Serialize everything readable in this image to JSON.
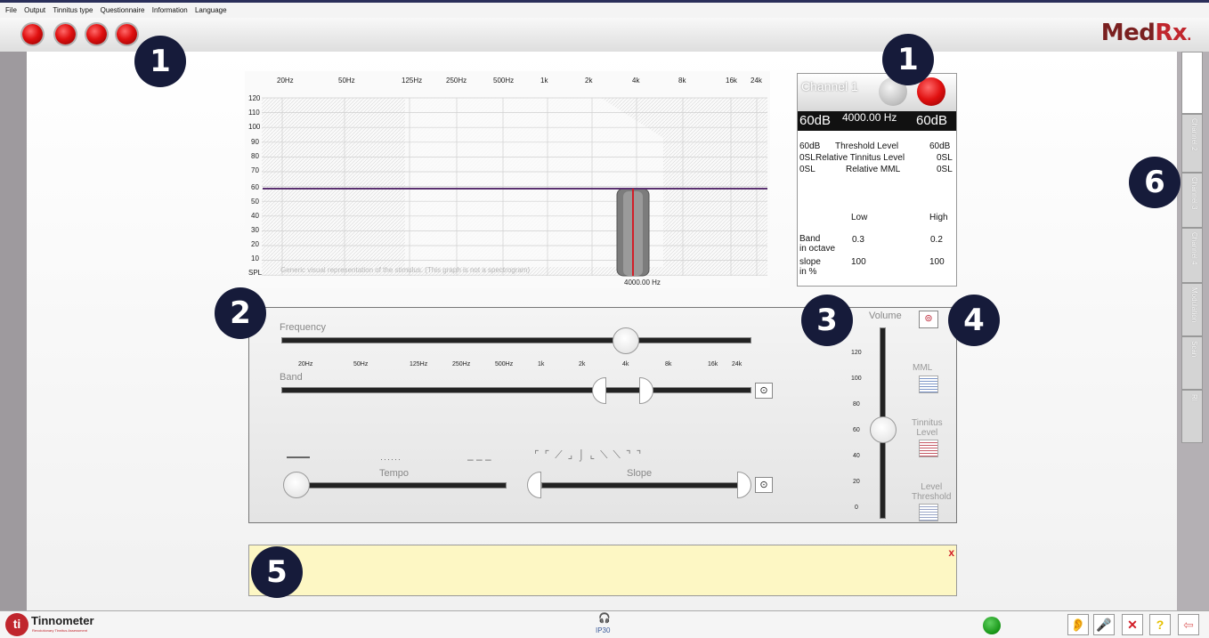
{
  "menu": [
    "File",
    "Output",
    "Tinnitus type",
    "Questionnaire",
    "Information",
    "Language"
  ],
  "logo": {
    "med": "Med",
    "rx": "Rx",
    "dot": "."
  },
  "badges": [
    "1",
    "1",
    "2",
    "3",
    "4",
    "5",
    "6"
  ],
  "graph": {
    "freq_labels": [
      "20Hz",
      "50Hz",
      "125Hz",
      "250Hz",
      "500Hz",
      "1k",
      "2k",
      "4k",
      "8k",
      "16k",
      "24k"
    ],
    "y_labels": [
      "120",
      "110",
      "100",
      "90",
      "80",
      "70",
      "60",
      "50",
      "40",
      "30",
      "20",
      "10",
      "SPL"
    ],
    "caption": "Generic visual representation of the stimulus. (This graph is not a spectrogram)",
    "freq_readout": "4000.00 Hz",
    "level_line_db": 60,
    "accent": "#d21e28",
    "line_color": "#5a3070"
  },
  "channel": {
    "title": "Channel 1",
    "left_db": "60dB",
    "freq": "4000.00 Hz",
    "right_db": "60dB",
    "rows": [
      {
        "left": "60dB",
        "label": "Threshold Level",
        "right": "60dB"
      },
      {
        "left": "0SL",
        "label": "Relative Tinnitus Level",
        "right": "0SL"
      },
      {
        "left": "0SL",
        "label": "Relative MML",
        "right": "0SL"
      }
    ],
    "low_label": "Low",
    "high_label": "High",
    "band_label": "Band\nin octave",
    "band_low": "0.3",
    "band_high": "0.2",
    "slope_label": "slope\nin %",
    "slope_low": "100",
    "slope_high": "100"
  },
  "controls": {
    "frequency_label": "Frequency",
    "band_label": "Band",
    "tempo_label": "Tempo",
    "slope_label": "Slope",
    "volume_label": "Volume",
    "freq_ticks": [
      "20Hz",
      "50Hz",
      "125Hz",
      "250Hz",
      "500Hz",
      "1k",
      "2k",
      "4k",
      "8k",
      "16k",
      "24k"
    ],
    "volume_ticks": [
      "120",
      "100",
      "80",
      "60",
      "40",
      "20",
      "0"
    ],
    "mml_label": "MML",
    "tinnitus_level_label": "Tinnitus\nLevel",
    "level_threshold_label": "Level\nThreshold"
  },
  "note": {
    "close": "x"
  },
  "tabs": [
    "Channel 2",
    "Channel 3",
    "Channel 4",
    "Modulation",
    "Scan",
    "RI"
  ],
  "status": {
    "brand": "Tinnometer",
    "brand_sub": "Revolutionary Tinnitus Assessment",
    "ti": "ti",
    "headphone": "IP30"
  }
}
